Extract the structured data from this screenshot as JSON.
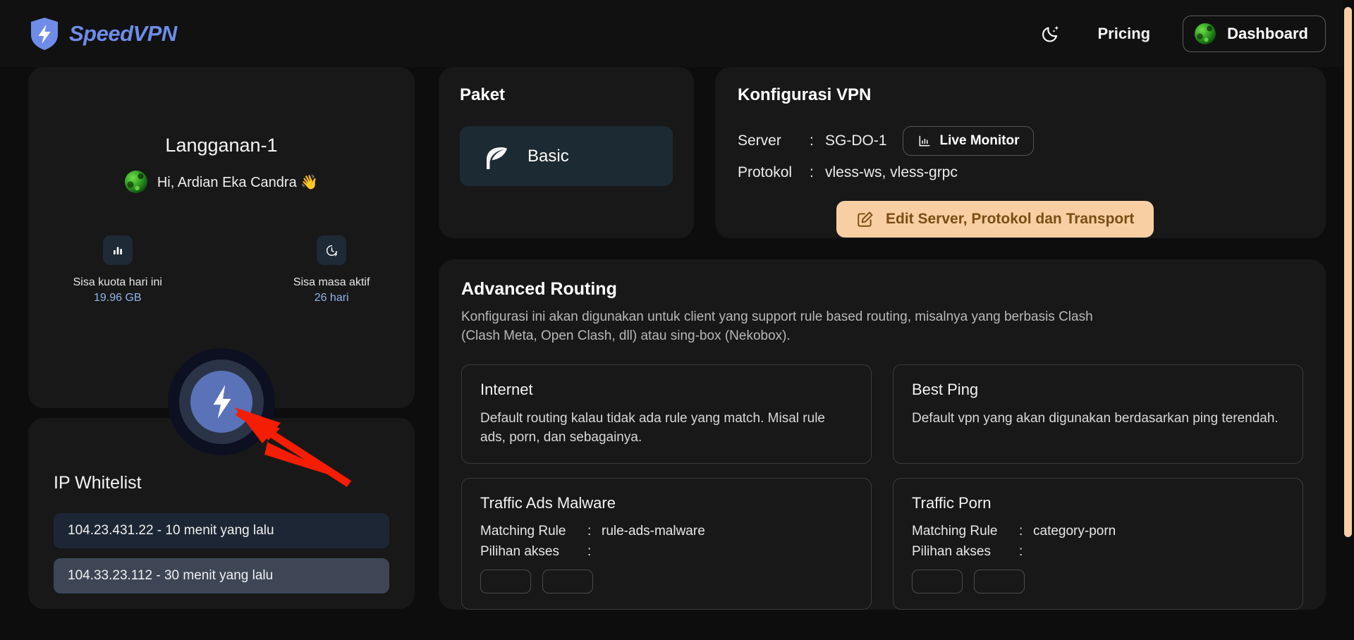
{
  "header": {
    "brand_name": "SpeedVPN",
    "theme_toggle_icon": "moon-sparkle-icon",
    "pricing_label": "Pricing",
    "dashboard_label": "Dashboard"
  },
  "profile": {
    "plan_title": "Langganan-1",
    "greeting": "Hi, Ardian Eka Candra 👋",
    "stats": [
      {
        "icon": "bar-chart-icon",
        "label": "Sisa kuota hari ini",
        "value": "19.96 GB"
      },
      {
        "icon": "clock-lightning-icon",
        "label": "Sisa masa aktif",
        "value": "26 hari"
      }
    ],
    "power_button_icon": "lightning-bolt-icon"
  },
  "ip_whitelist": {
    "title": "IP Whitelist",
    "items": [
      "104.23.431.22 - 10 menit yang lalu",
      "104.33.23.112 - 30 menit yang lalu"
    ]
  },
  "paket": {
    "title": "Paket",
    "icon": "leaf-icon",
    "name": "Basic"
  },
  "vpn_config": {
    "title": "Konfigurasi VPN",
    "server_key": "Server",
    "server_value": "SG-DO-1",
    "colon": ":",
    "live_monitor_label": "Live Monitor",
    "live_monitor_icon": "bar-chart-icon",
    "protocol_key": "Protokol",
    "protocol_value": "vless-ws, vless-grpc",
    "edit_button_label": "Edit Server, Protokol dan Transport",
    "edit_button_icon": "pencil-square-icon"
  },
  "advanced_routing": {
    "title": "Advanced Routing",
    "description": "Konfigurasi ini akan digunakan untuk client yang support rule based routing, misalnya yang berbasis Clash (Clash Meta, Open Clash, dll) atau sing-box (Nekobox).",
    "boxes": [
      {
        "name": "Internet",
        "description": "Default routing kalau tidak ada rule yang match. Misal rule ads, porn, dan sebagainya."
      },
      {
        "name": "Best Ping",
        "description": "Default vpn yang akan digunakan berdasarkan ping terendah."
      }
    ],
    "traffic_boxes": [
      {
        "name": "Traffic Ads Malware",
        "rule_key": "Matching Rule",
        "rule_colon": ":",
        "rule_value": "rule-ads-malware",
        "access_key": "Pilihan akses",
        "access_colon": ":"
      },
      {
        "name": "Traffic Porn",
        "rule_key": "Matching Rule",
        "rule_colon": ":",
        "rule_value": "category-porn",
        "access_key": "Pilihan akses",
        "access_colon": ":"
      }
    ]
  },
  "annotation": {
    "arrow_color": "#f51d02",
    "arrow_target": "power-toggle-button"
  },
  "colors": {
    "background": "#0d0d0d",
    "card": "#181818",
    "accent_blue": "#6e8ce8",
    "accent_peach": "#f7cfa3",
    "stat_value_blue": "#93b4e8"
  }
}
